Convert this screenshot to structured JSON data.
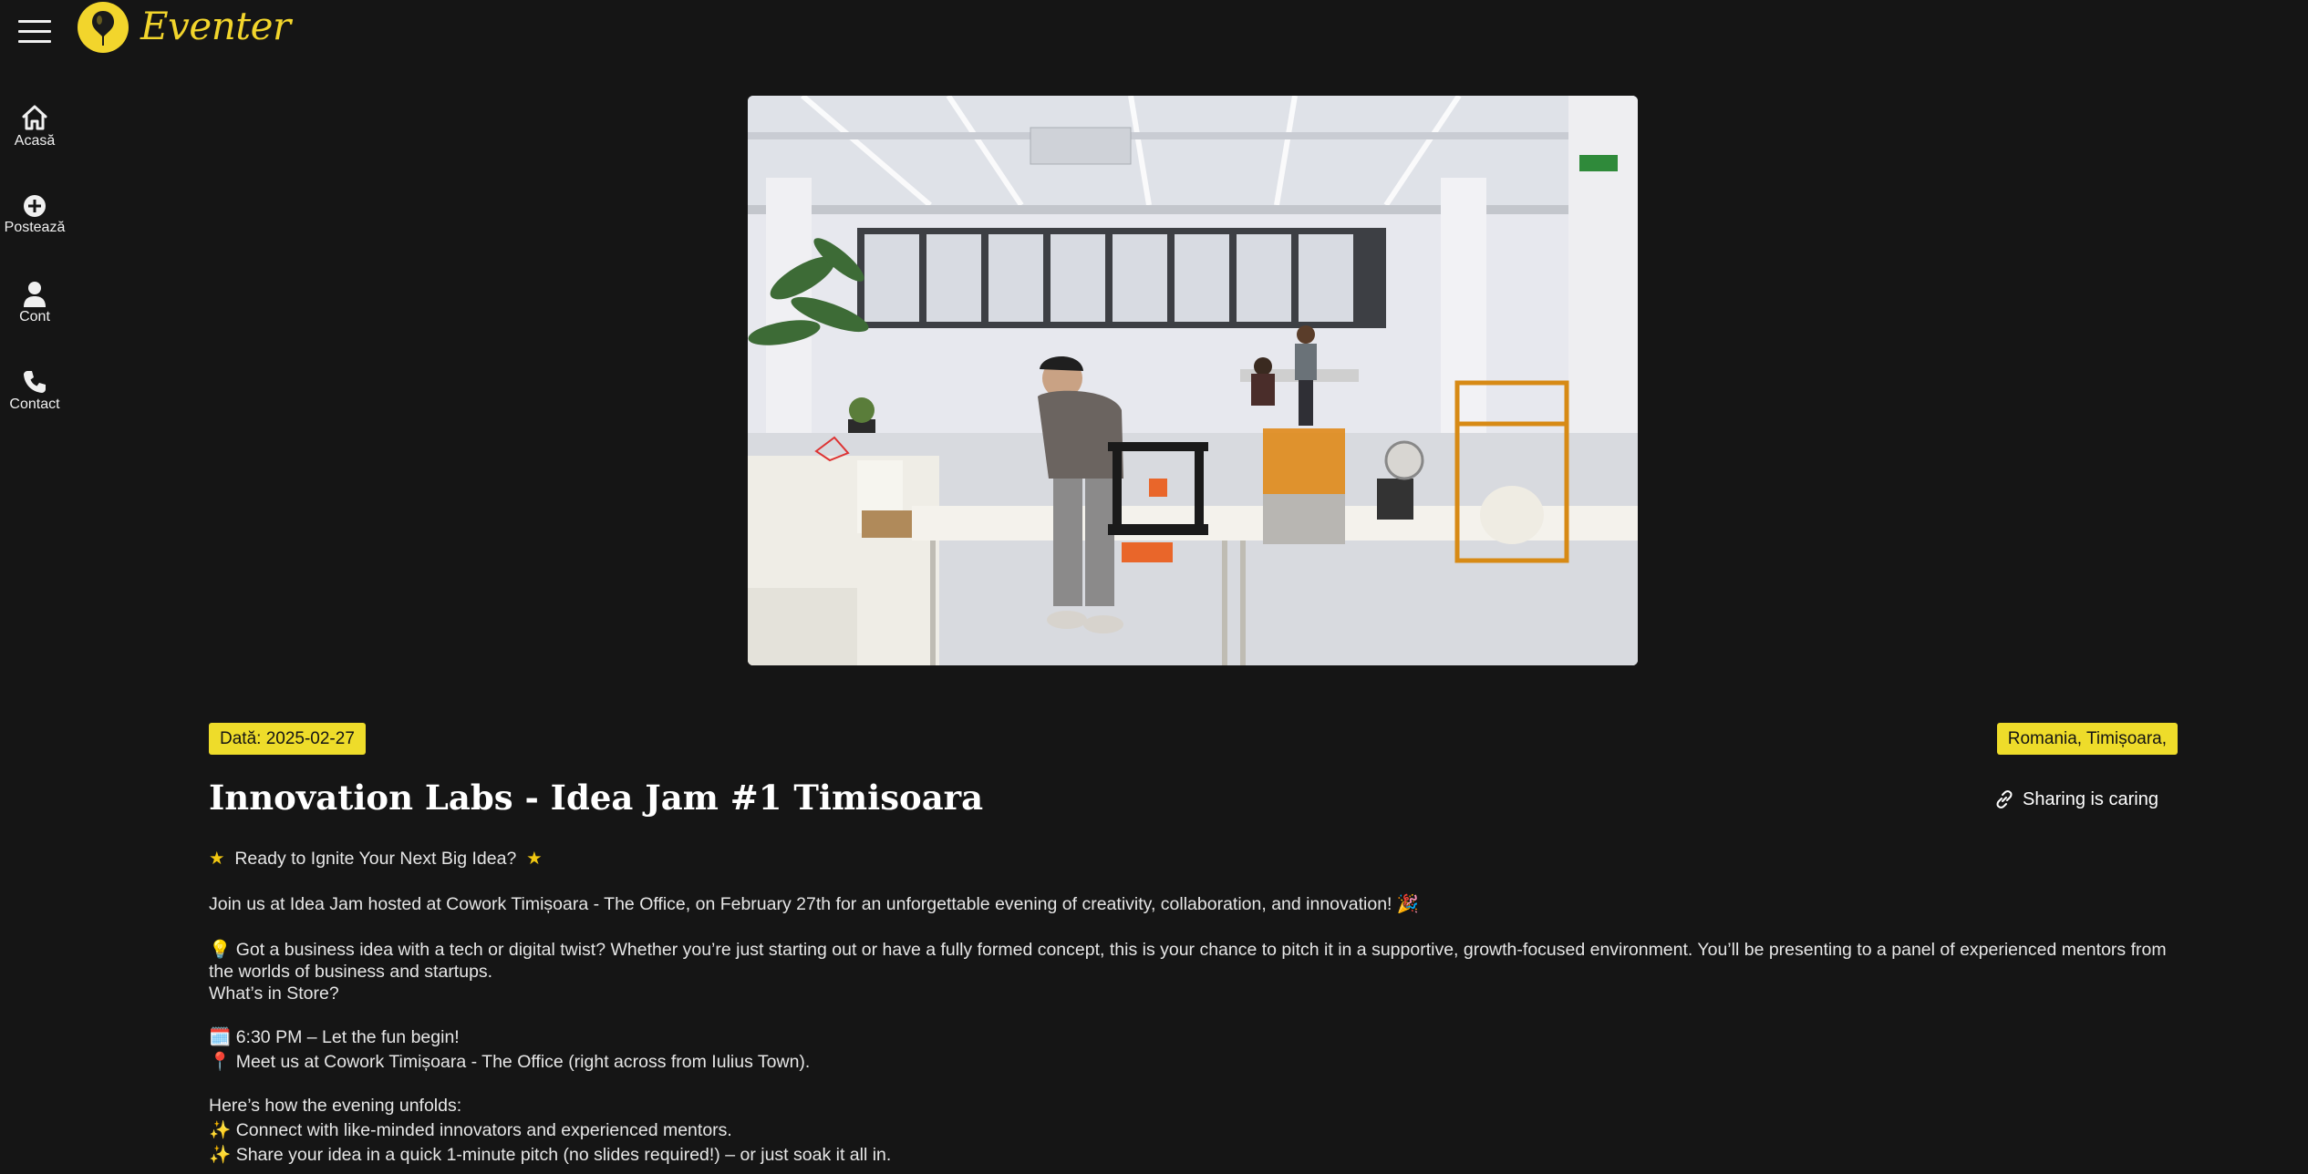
{
  "app": {
    "logo_text": "Eventer",
    "brand_color": "#f2d52c"
  },
  "sidebar": {
    "items": [
      {
        "label": "Acasă",
        "icon": "home-icon"
      },
      {
        "label": "Postează",
        "icon": "plus-circle-icon"
      },
      {
        "label": "Cont",
        "icon": "user-icon"
      },
      {
        "label": "Contact",
        "icon": "phone-icon"
      }
    ]
  },
  "event": {
    "date_badge": "Dată: 2025-02-27",
    "location_badge": "Romania, Timișoara,",
    "title": "Innovation Labs - Idea Jam #1 Timisoara",
    "share_label": "Sharing is caring",
    "image_alt": "3D printers in a bright coworking space",
    "description": {
      "star_line": "Ready to Ignite Your Next Big Idea?",
      "star_glyph": "★",
      "intro": "Join us at Idea Jam hosted at Cowork Timișoara - The Office, on February 27th for an unforgettable evening of creativity, collaboration, and innovation! 🎉",
      "pitch_line1": "💡 Got a business idea with a tech or digital twist? Whether you’re just starting out or have a fully formed concept, this is your chance to pitch it in a supportive, growth-focused environment. You’ll be presenting to a panel of experienced mentors from the worlds of business and startups.",
      "whats_in_store": "What’s in Store?",
      "time_line": "🗓️ 6:30 PM – Let the fun begin!",
      "place_line": "📍 Meet us at Cowork Timișoara - The Office (right across from Iulius Town).",
      "unfolds": "Here’s how the evening unfolds:",
      "bullet1": "✨ Connect with like-minded innovators and experienced mentors.",
      "bullet2": "✨ Share your idea in a quick 1-minute pitch (no slides required!) – or just soak it all in."
    }
  }
}
